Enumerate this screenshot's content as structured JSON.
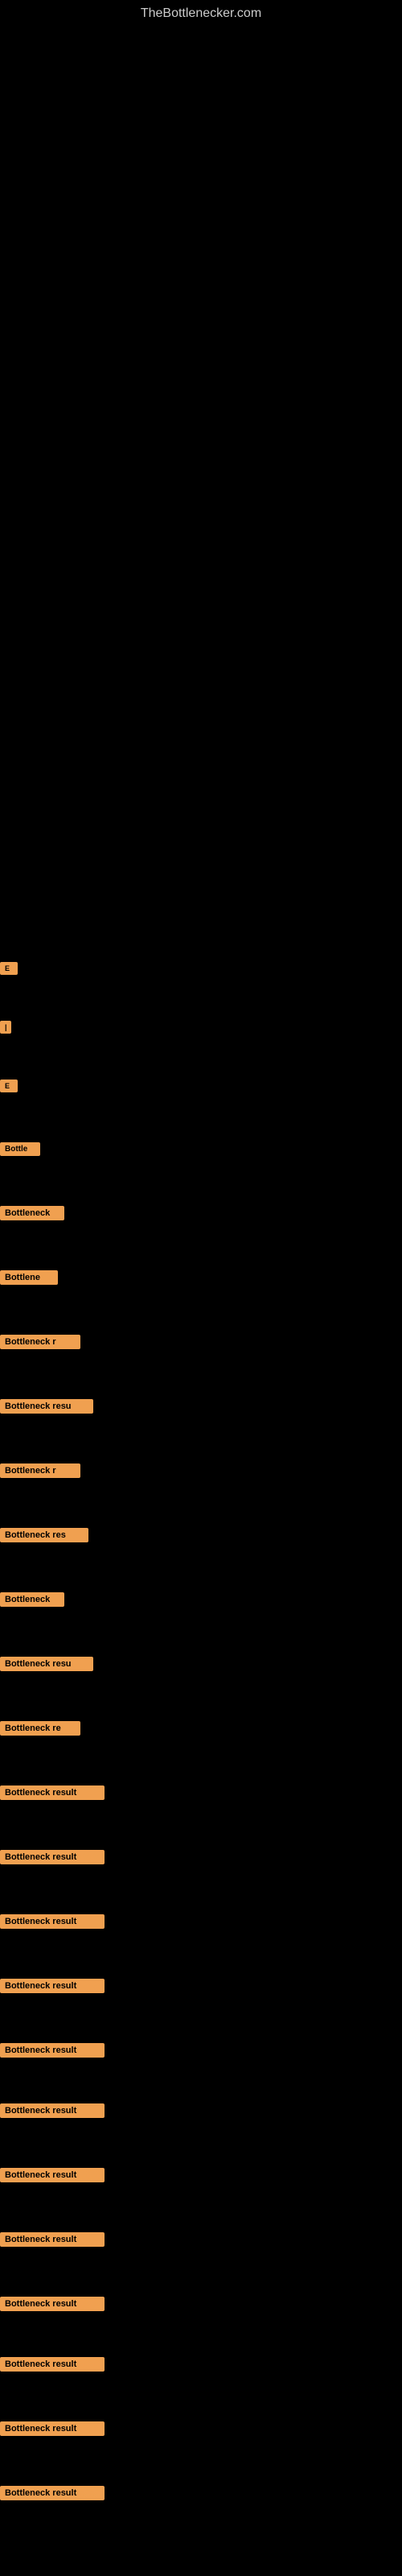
{
  "site": {
    "title": "TheBottlenecker.com"
  },
  "items": [
    {
      "id": 1,
      "label": "E",
      "size_class": "item-1"
    },
    {
      "id": 2,
      "label": "|",
      "size_class": "item-2"
    },
    {
      "id": 3,
      "label": "E",
      "size_class": "item-3"
    },
    {
      "id": 4,
      "label": "Bottle",
      "size_class": "item-4"
    },
    {
      "id": 5,
      "label": "Bottleneck",
      "size_class": "item-5"
    },
    {
      "id": 6,
      "label": "Bottlene",
      "size_class": "item-6"
    },
    {
      "id": 7,
      "label": "Bottleneck r",
      "size_class": "item-7"
    },
    {
      "id": 8,
      "label": "Bottleneck resu",
      "size_class": "item-8"
    },
    {
      "id": 9,
      "label": "Bottleneck r",
      "size_class": "item-9"
    },
    {
      "id": 10,
      "label": "Bottleneck res",
      "size_class": "item-10"
    },
    {
      "id": 11,
      "label": "Bottleneck",
      "size_class": "item-11"
    },
    {
      "id": 12,
      "label": "Bottleneck resu",
      "size_class": "item-12"
    },
    {
      "id": 13,
      "label": "Bottleneck re",
      "size_class": "item-13"
    },
    {
      "id": 14,
      "label": "Bottleneck result",
      "size_class": "item-14"
    },
    {
      "id": 15,
      "label": "Bottleneck result",
      "size_class": "item-15"
    },
    {
      "id": 16,
      "label": "Bottleneck result",
      "size_class": "item-16"
    },
    {
      "id": 17,
      "label": "Bottleneck result",
      "size_class": "item-17"
    },
    {
      "id": 18,
      "label": "Bottleneck result",
      "size_class": "item-18"
    },
    {
      "id": 19,
      "label": "Bottleneck result",
      "size_class": "item-19"
    },
    {
      "id": 20,
      "label": "Bottleneck result",
      "size_class": "item-20"
    },
    {
      "id": 21,
      "label": "Bottleneck result",
      "size_class": "item-21"
    },
    {
      "id": 22,
      "label": "Bottleneck result",
      "size_class": "item-22"
    },
    {
      "id": 23,
      "label": "Bottleneck result",
      "size_class": "item-23"
    },
    {
      "id": 24,
      "label": "Bottleneck result",
      "size_class": "item-24"
    },
    {
      "id": 25,
      "label": "Bottleneck result",
      "size_class": "item-25"
    }
  ]
}
